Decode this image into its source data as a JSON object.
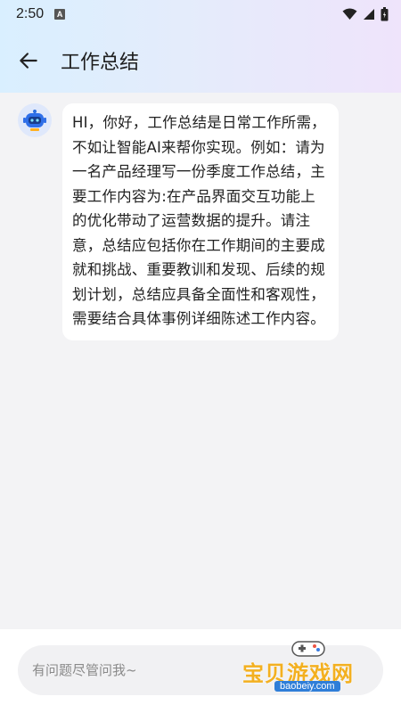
{
  "status_bar": {
    "time": "2:50",
    "notification_letter": "A",
    "icons": [
      "wifi-icon",
      "signal-icon",
      "battery-icon"
    ]
  },
  "app_bar": {
    "title": "工作总结",
    "back_icon": "arrow-left-icon"
  },
  "chat": {
    "avatar_icon": "robot-icon",
    "messages": [
      {
        "sender": "bot",
        "text": "HI，你好，工作总结是日常工作所需，不如让智能AI来帮你实现。例如：请为一名产品经理写一份季度工作总结，主要工作内容为:在产品界面交互功能上的优化带动了运营数据的提升。请注意，总结应包括你在工作期间的主要成就和挑战、重要教训和发现、后续的规划计划，总结应具备全面性和客观性，需要结合具体事例详细陈述工作内容。"
      }
    ]
  },
  "input": {
    "placeholder": "有问题尽管问我~",
    "value": ""
  },
  "watermark": {
    "text": "宝贝游戏网",
    "url": "baobeiy.com"
  },
  "colors": {
    "background": "#f3f3f5",
    "accent": "#3d8de8",
    "watermark": "#f3b020"
  }
}
